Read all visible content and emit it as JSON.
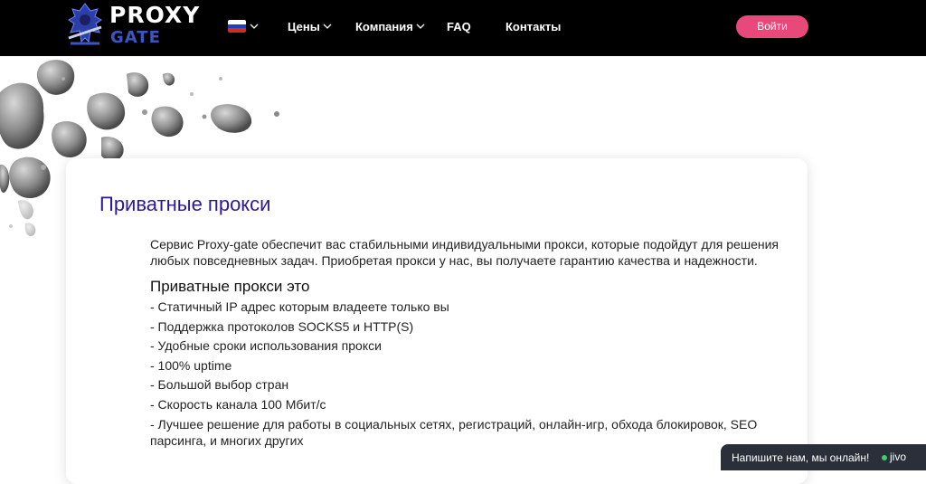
{
  "header": {
    "logo": {
      "line1": "PROXY",
      "line2": "GATE"
    },
    "nav": [
      {
        "label": "Цены"
      },
      {
        "label": "Компания"
      },
      {
        "label": "FAQ"
      },
      {
        "label": "Контакты"
      }
    ],
    "login_label": "Войти",
    "colors": {
      "bar": "#000000",
      "login": "#e9487a",
      "logo_accent": "#3b56c4"
    }
  },
  "content": {
    "title": "Приватные прокси",
    "intro": "Сервис Proxy-gate обеспечит вас стабильными индивидуальными прокси, которые подойдут для решения любых повседневных задач. Приобретая прокси у нас, вы получаете гарантию качества и надежности.",
    "subheading": "Приватные прокси это",
    "features": [
      "- Статичный IP адрес которым владеете только вы",
      "- Поддержка протоколов SOCKS5 и HTTP(S)",
      "- Удобные сроки использования прокси",
      "- 100% uptime",
      "- Большой выбор стран",
      "- Скорость канала 100 Мбит/с",
      "- Лучшее решение для работы в социальных сетях, регистраций, онлайн-игр, обхода блокировок, SEO парсинга, и многих других"
    ],
    "title_color": "#2a1a94"
  },
  "chat": {
    "text": "Напишите нам, мы онлайн!",
    "brand": "jivo"
  }
}
